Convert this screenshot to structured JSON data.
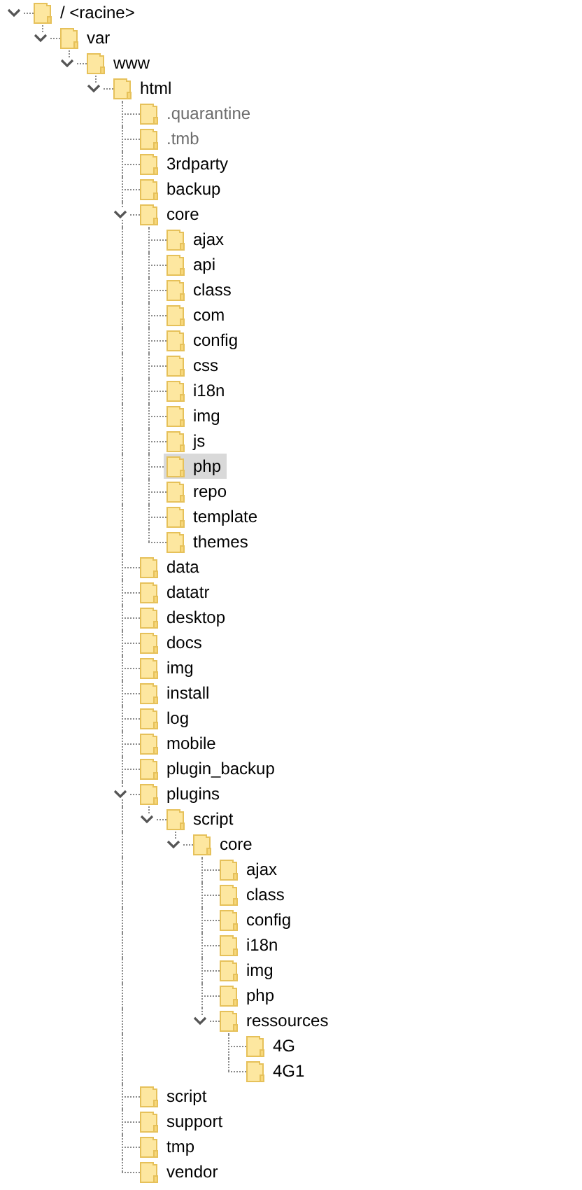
{
  "tree": [
    {
      "name": "/ <racine>",
      "expanded": true,
      "selected": false,
      "hidden": false,
      "children": [
        {
          "name": "var",
          "expanded": true,
          "selected": false,
          "hidden": false,
          "children": [
            {
              "name": "www",
              "expanded": true,
              "selected": false,
              "hidden": false,
              "children": [
                {
                  "name": "html",
                  "expanded": true,
                  "selected": false,
                  "hidden": false,
                  "children": [
                    {
                      "name": ".quarantine",
                      "selected": false,
                      "hidden": true
                    },
                    {
                      "name": ".tmb",
                      "selected": false,
                      "hidden": true
                    },
                    {
                      "name": "3rdparty",
                      "selected": false,
                      "hidden": false
                    },
                    {
                      "name": "backup",
                      "selected": false,
                      "hidden": false
                    },
                    {
                      "name": "core",
                      "expanded": true,
                      "selected": false,
                      "hidden": false,
                      "children": [
                        {
                          "name": "ajax",
                          "selected": false,
                          "hidden": false
                        },
                        {
                          "name": "api",
                          "selected": false,
                          "hidden": false
                        },
                        {
                          "name": "class",
                          "selected": false,
                          "hidden": false
                        },
                        {
                          "name": "com",
                          "selected": false,
                          "hidden": false
                        },
                        {
                          "name": "config",
                          "selected": false,
                          "hidden": false
                        },
                        {
                          "name": "css",
                          "selected": false,
                          "hidden": false
                        },
                        {
                          "name": "i18n",
                          "selected": false,
                          "hidden": false
                        },
                        {
                          "name": "img",
                          "selected": false,
                          "hidden": false
                        },
                        {
                          "name": "js",
                          "selected": false,
                          "hidden": false
                        },
                        {
                          "name": "php",
                          "selected": true,
                          "hidden": false
                        },
                        {
                          "name": "repo",
                          "selected": false,
                          "hidden": false
                        },
                        {
                          "name": "template",
                          "selected": false,
                          "hidden": false
                        },
                        {
                          "name": "themes",
                          "selected": false,
                          "hidden": false
                        }
                      ]
                    },
                    {
                      "name": "data",
                      "selected": false,
                      "hidden": false
                    },
                    {
                      "name": "datatr",
                      "selected": false,
                      "hidden": false
                    },
                    {
                      "name": "desktop",
                      "selected": false,
                      "hidden": false
                    },
                    {
                      "name": "docs",
                      "selected": false,
                      "hidden": false
                    },
                    {
                      "name": "img",
                      "selected": false,
                      "hidden": false
                    },
                    {
                      "name": "install",
                      "selected": false,
                      "hidden": false
                    },
                    {
                      "name": "log",
                      "selected": false,
                      "hidden": false
                    },
                    {
                      "name": "mobile",
                      "selected": false,
                      "hidden": false
                    },
                    {
                      "name": "plugin_backup",
                      "selected": false,
                      "hidden": false
                    },
                    {
                      "name": "plugins",
                      "expanded": true,
                      "selected": false,
                      "hidden": false,
                      "children": [
                        {
                          "name": "script",
                          "expanded": true,
                          "selected": false,
                          "hidden": false,
                          "children": [
                            {
                              "name": "core",
                              "expanded": true,
                              "selected": false,
                              "hidden": false,
                              "children": [
                                {
                                  "name": "ajax",
                                  "selected": false,
                                  "hidden": false
                                },
                                {
                                  "name": "class",
                                  "selected": false,
                                  "hidden": false
                                },
                                {
                                  "name": "config",
                                  "selected": false,
                                  "hidden": false
                                },
                                {
                                  "name": "i18n",
                                  "selected": false,
                                  "hidden": false
                                },
                                {
                                  "name": "img",
                                  "selected": false,
                                  "hidden": false
                                },
                                {
                                  "name": "php",
                                  "selected": false,
                                  "hidden": false
                                },
                                {
                                  "name": "ressources",
                                  "expanded": true,
                                  "selected": false,
                                  "hidden": false,
                                  "children": [
                                    {
                                      "name": "4G",
                                      "selected": false,
                                      "hidden": false
                                    },
                                    {
                                      "name": "4G1",
                                      "selected": false,
                                      "hidden": false
                                    }
                                  ]
                                }
                              ]
                            }
                          ]
                        }
                      ]
                    },
                    {
                      "name": "script",
                      "selected": false,
                      "hidden": false
                    },
                    {
                      "name": "support",
                      "selected": false,
                      "hidden": false
                    },
                    {
                      "name": "tmp",
                      "selected": false,
                      "hidden": false
                    },
                    {
                      "name": "vendor",
                      "selected": false,
                      "hidden": false
                    }
                  ]
                }
              ]
            }
          ]
        }
      ]
    }
  ]
}
